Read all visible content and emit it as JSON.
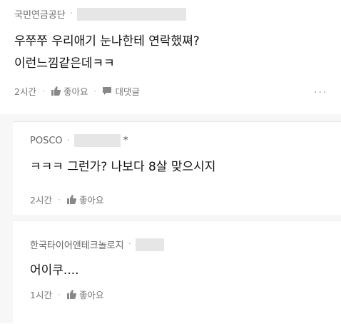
{
  "post": {
    "author": "국민연금공단",
    "text_line1": "우쭈쭈 우리애기 눈나한테 연락했쪄?",
    "text_line2": "이런느낌같은데ㅋㅋ",
    "time": "2시간",
    "like_label": "좋아요",
    "reply_label": "대댓글",
    "more_icon": "more-horizontal-icon"
  },
  "replies": [
    {
      "author": "POSCO",
      "badge": "*",
      "text": "ㅋㅋㅋ 그런가? 나보다 8살 맞으시지",
      "time": "2시간",
      "like_label": "좋아요"
    },
    {
      "author": "한국타이어앤테크놀로지",
      "text": "어이쿠....",
      "time": "1시간",
      "like_label": "좋아요"
    }
  ],
  "colors": {
    "mask": "#e6e6e6",
    "reply_bg": "#f7f7f7"
  }
}
